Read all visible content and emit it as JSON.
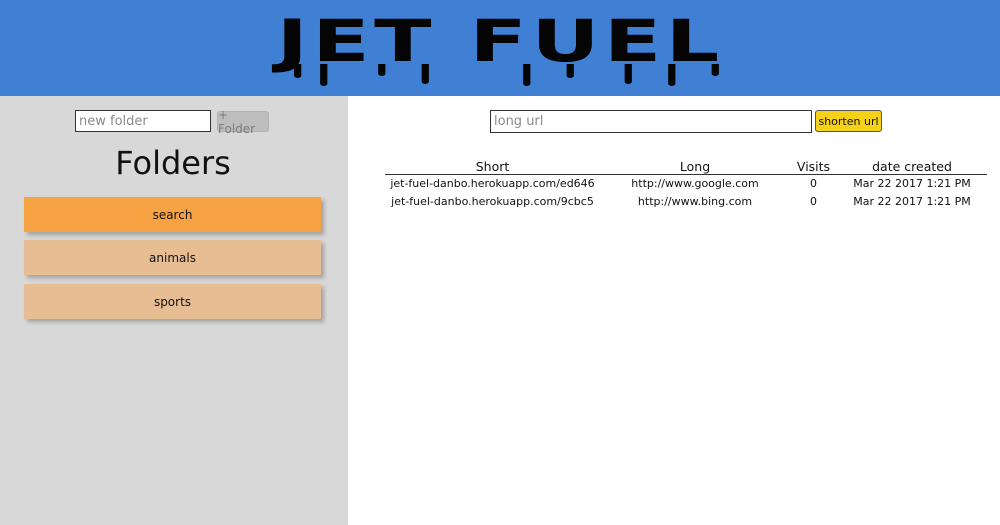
{
  "header": {
    "logo_text": "JET FUEL",
    "background_color": "#3f80d4"
  },
  "sidebar": {
    "new_folder_placeholder": "new folder",
    "add_folder_label": "+ Folder",
    "title": "Folders",
    "folders": [
      {
        "label": "search",
        "active": true
      },
      {
        "label": "animals",
        "active": false
      },
      {
        "label": "sports",
        "active": false
      }
    ],
    "colors": {
      "active": "#f5a243",
      "inactive": "#e7bd94",
      "background": "#d8d8d8"
    }
  },
  "main": {
    "url_placeholder": "long url",
    "shorten_label": "shorten url",
    "shorten_color": "#f5d117",
    "table": {
      "headers": [
        "Short",
        "Long",
        "Visits",
        "date created"
      ],
      "rows": [
        {
          "short": "jet-fuel-danbo.herokuapp.com/ed646",
          "long": "http://www.google.com",
          "visits": "0",
          "created": "Mar 22 2017 1:21 PM"
        },
        {
          "short": "jet-fuel-danbo.herokuapp.com/9cbc5",
          "long": "http://www.bing.com",
          "visits": "0",
          "created": "Mar 22 2017 1:21 PM"
        }
      ]
    }
  }
}
